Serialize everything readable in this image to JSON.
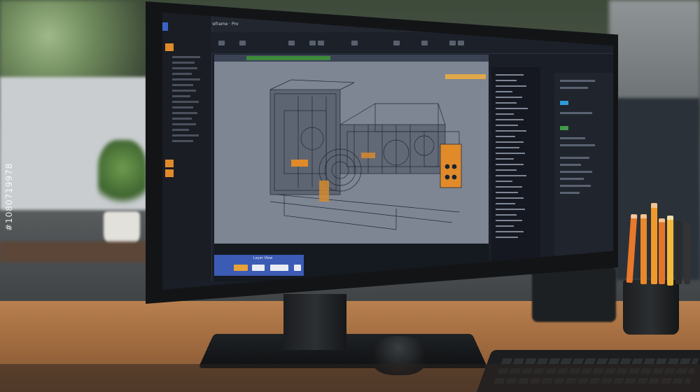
{
  "scene": {
    "description_objects": [
      "monitor",
      "cad-software",
      "desk",
      "keyboard",
      "mouse",
      "pencil-cup",
      "plant"
    ],
    "colors": {
      "accent_orange": "#e08a2a",
      "viewport_gray": "#7e8593",
      "ui_dark": "#1a1e26",
      "wood": "#a46d40"
    }
  },
  "app": {
    "window_title": "Wireframe · Pro",
    "timeline_chip_label": "Layer View"
  },
  "watermark": {
    "stock_id": "#1080719978"
  }
}
